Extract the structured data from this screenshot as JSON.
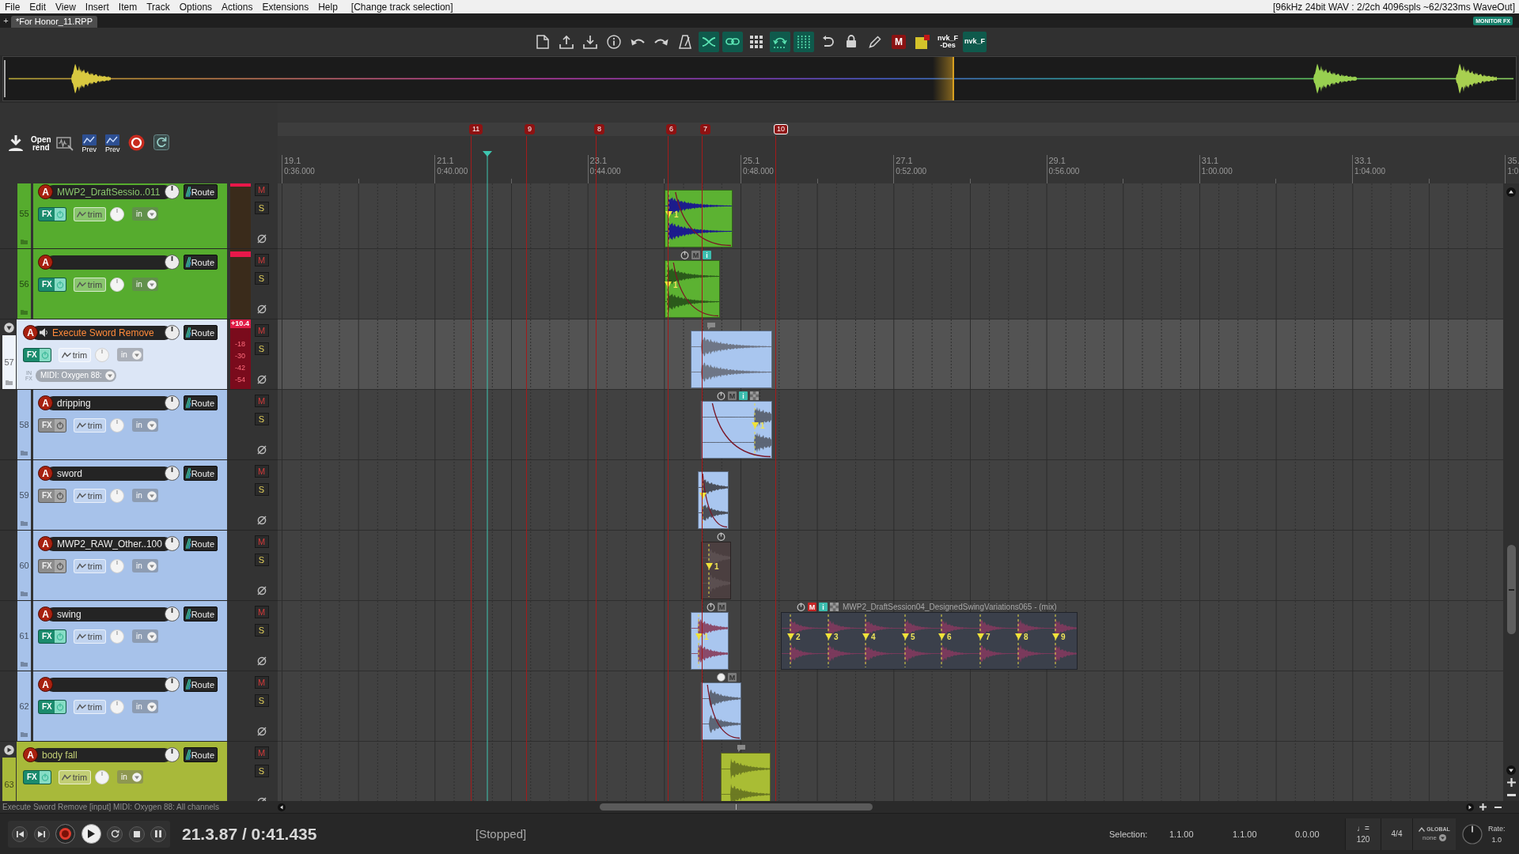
{
  "menu_bar": {
    "items": [
      "File",
      "Edit",
      "View",
      "Insert",
      "Item",
      "Track",
      "Options",
      "Actions",
      "Extensions",
      "Help"
    ],
    "hint": "[Change track selection]",
    "status": "[96kHz 24bit WAV : 2/2ch 4096spls ~62/323ms WaveOut]"
  },
  "project_tabs": {
    "new_tab": "+",
    "tabs": [
      {
        "label": "*For Honor_11.RPP",
        "selected": true
      }
    ],
    "monitor_fx": "MONITOR FX"
  },
  "main_toolbar": [
    {
      "on": false
    },
    {
      "on": false
    },
    {
      "on": false
    },
    {
      "on": false
    },
    {
      "on": false
    },
    {
      "on": false
    },
    {
      "on": false
    },
    {
      "on": true
    },
    {
      "on": true
    },
    {
      "on": false
    },
    {
      "on": true
    },
    {
      "on": true
    },
    {
      "on": false
    },
    {
      "on": false
    },
    {
      "on": false
    },
    {
      "label": "M",
      "on": false
    },
    {
      "on": false
    },
    {
      "label": "nvk_F -Des",
      "on": false
    },
    {
      "label": "nvk_F",
      "on": true
    }
  ],
  "render_toolbar": {
    "open_label": "Open rend",
    "preview_labels": [
      "Prev",
      "Prev"
    ]
  },
  "ruler": {
    "markers": [
      {
        "label": "11",
        "selected": false
      },
      {
        "label": "9",
        "selected": false
      },
      {
        "label": "8",
        "selected": false
      },
      {
        "label": "6",
        "selected": false
      },
      {
        "label": "7",
        "selected": false
      },
      {
        "label": "10",
        "selected": true
      }
    ],
    "ticks": [
      {
        "bar": "19.1",
        "time": "0:36.000"
      },
      {
        "bar": "21.1",
        "time": "0:40.000"
      },
      {
        "bar": "23.1",
        "time": "0:44.000"
      },
      {
        "bar": "25.1",
        "time": "0:48.000"
      },
      {
        "bar": "27.1",
        "time": "0:52.000"
      },
      {
        "bar": "29.1",
        "time": "0:56.000"
      },
      {
        "bar": "31.1",
        "time": "1:00.000"
      },
      {
        "bar": "33.1",
        "time": "1:04.000"
      },
      {
        "bar": "35.",
        "time": "1:0"
      }
    ]
  },
  "tracks": [
    {
      "children": [
        {
          "number": "55",
          "name": "MWP2_DraftSessio..011",
          "tinted_name": true,
          "color": "#56ac2e",
          "selected": false,
          "arm": "A",
          "meter": {
            "clip": true
          },
          "fx": "FX",
          "fx_on": true,
          "trim": "trim",
          "input": "in",
          "route": "Route",
          "mute": "M",
          "solo": "S",
          "items": [
            {
              "color": "#5cb232",
              "waveform": {
                "color": "#1c1c8c"
              },
              "fade_out": true,
              "take_markers": [
                {
                  "kind": "numbered",
                  "label": "1"
                }
              ]
            }
          ]
        },
        {
          "number": "56",
          "color": "#56ac2e",
          "selected": false,
          "arm": "A",
          "meter": {
            "clip": true
          },
          "fx": "FX",
          "fx_on": true,
          "trim": "trim",
          "input": "in",
          "route": "Route",
          "mute": "M",
          "solo": "S",
          "items": [
            {
              "color": "#5cb232",
              "waveform": {
                "color": "#2b5a1b"
              },
              "fade_out": true,
              "header": [
                {
                  "kind": "power"
                },
                {
                  "kind": "mute",
                  "label": "M",
                  "on": false
                },
                {
                  "kind": "info",
                  "label": "i",
                  "on": true
                }
              ],
              "take_markers": [
                {
                  "kind": "numbered",
                  "label": "1"
                }
              ]
            }
          ]
        }
      ]
    },
    {
      "number": "57",
      "name": "Execute Sword Remove",
      "color": "#dce6f6",
      "selected": true,
      "expanded": true,
      "arm": "A",
      "monitoring": true,
      "meter": {
        "armed": true,
        "peak": "+10.4",
        "scale": [
          "-18",
          "-30",
          "-42",
          "-54"
        ]
      },
      "fx": "FX",
      "fx_on": true,
      "trim": "trim",
      "input": "in",
      "route": "Route",
      "mute": "M",
      "solo": "S",
      "input_fx": "IN FX",
      "midi_input": "MIDI: Oxygen 88:",
      "items": [
        {
          "color": "#a9c6ef",
          "waveform": {
            "color": "#6e7686"
          },
          "header": [
            {
              "kind": "note"
            }
          ]
        }
      ],
      "children": [
        {
          "number": "58",
          "name": "dripping",
          "tinted_name": false,
          "color": "#a7c2ea",
          "selected": false,
          "arm": "A",
          "fx": "FX",
          "fx_on": false,
          "trim": "trim",
          "input": "in",
          "route": "Route",
          "mute": "M",
          "solo": "S",
          "items": [
            {
              "color": "#a9c6ef",
              "waveform": {
                "color": "#5d6676"
              },
              "fade_out": true,
              "header": [
                {
                  "kind": "power"
                },
                {
                  "kind": "mute",
                  "label": "M",
                  "on": false
                },
                {
                  "kind": "info",
                  "label": "i",
                  "on": true
                },
                {
                  "kind": "envelope"
                }
              ],
              "take_markers": [
                {
                  "kind": "numbered",
                  "label": "1"
                }
              ]
            }
          ]
        },
        {
          "number": "59",
          "name": "sword",
          "tinted_name": false,
          "color": "#a7c2ea",
          "selected": false,
          "arm": "A",
          "fx": "FX",
          "fx_on": false,
          "trim": "trim",
          "input": "in",
          "route": "Route",
          "mute": "M",
          "solo": "S",
          "items": [
            {
              "color": "#a9c6ef",
              "waveform": {
                "color": "#4a4e58"
              },
              "fade_out": true,
              "take_markers": [
                {
                  "kind": "plain"
                }
              ]
            }
          ]
        },
        {
          "number": "60",
          "name": "MWP2_RAW_Other..100",
          "tinted_name": false,
          "color": "#a7c2ea",
          "selected": false,
          "arm": "A",
          "fx": "FX",
          "fx_on": false,
          "trim": "trim",
          "input": "in",
          "route": "Route",
          "mute": "M",
          "solo": "S",
          "items": [
            {
              "color": "#4b3f40",
              "waveform": {
                "color": "#5b4f50"
              },
              "header": [
                {
                  "kind": "power"
                }
              ],
              "take_markers": [
                {
                  "kind": "numbered",
                  "label": "1"
                }
              ]
            }
          ]
        },
        {
          "number": "61",
          "name": "swing",
          "tinted_name": false,
          "color": "#a7c2ea",
          "selected": false,
          "arm": "A",
          "fx": "FX",
          "fx_on": true,
          "trim": "trim",
          "input": "in",
          "route": "Route",
          "mute": "M",
          "solo": "S",
          "items": [
            {
              "color": "#a9c6ef",
              "waveform": {
                "color": "#8a4a6a"
              },
              "header": [
                {
                  "kind": "power"
                },
                {
                  "kind": "mute",
                  "label": "M",
                  "on": false
                }
              ],
              "take_markers": [
                {
                  "kind": "numbered",
                  "label": "1"
                }
              ]
            },
            {
              "name": "MWP2_DraftSession04_DesignedSwingVariations065 - (mix)",
              "color": "#3b404b",
              "waveform": {
                "color": "#7a3a5c"
              },
              "header": [
                {
                  "kind": "power"
                },
                {
                  "kind": "mute",
                  "label": "M",
                  "on": true
                },
                {
                  "kind": "info",
                  "label": "i",
                  "on": true
                },
                {
                  "kind": "envelope"
                }
              ],
              "take_markers": [
                {
                  "kind": "numbered",
                  "label": "2"
                },
                {
                  "kind": "numbered",
                  "label": "3"
                },
                {
                  "kind": "numbered",
                  "label": "4"
                },
                {
                  "kind": "numbered",
                  "label": "5"
                },
                {
                  "kind": "numbered",
                  "label": "6"
                },
                {
                  "kind": "numbered",
                  "label": "7"
                },
                {
                  "kind": "numbered",
                  "label": "8"
                },
                {
                  "kind": "numbered",
                  "label": "9"
                }
              ]
            }
          ]
        },
        {
          "number": "62",
          "color": "#a7c2ea",
          "selected": false,
          "arm": "A",
          "fx": "FX",
          "fx_on": true,
          "trim": "trim",
          "input": "in",
          "route": "Route",
          "mute": "M",
          "solo": "S",
          "items": [
            {
              "color": "#a9c6ef",
              "waveform": {
                "color": "#5d6676"
              },
              "fade_out": true,
              "header": [
                {
                  "kind": "volume"
                },
                {
                  "kind": "mute",
                  "label": "M",
                  "on": false
                }
              ]
            }
          ]
        }
      ]
    },
    {
      "number": "63",
      "name": "body fall",
      "tinted_name": true,
      "color": "#a8b93a",
      "selected": false,
      "expanded": false,
      "arm": "A",
      "fx": "FX",
      "fx_on": true,
      "trim": "trim",
      "input": "in",
      "route": "Route",
      "mute": "M",
      "solo": "S",
      "items": [
        {
          "color": "#a9bd34",
          "waveform": {
            "color": "#6c7a22"
          },
          "header": [
            {
              "kind": "note"
            }
          ]
        }
      ]
    }
  ],
  "status_line": "Execute Sword Remove [input] MIDI: Oxygen 88: All channels",
  "transport": {
    "position": "21.3.87 / 0:41.435",
    "state": "[Stopped]",
    "selection_label": "Selection:",
    "selection": [
      "1.1.00",
      "1.1.00",
      "0.0.00"
    ],
    "tempo_label": "♩=",
    "tempo": "120",
    "signature": "4/4",
    "automation_label": "GLOBAL",
    "automation_mode": "none",
    "rate_label": "Rate:",
    "rate": "1.0"
  }
}
